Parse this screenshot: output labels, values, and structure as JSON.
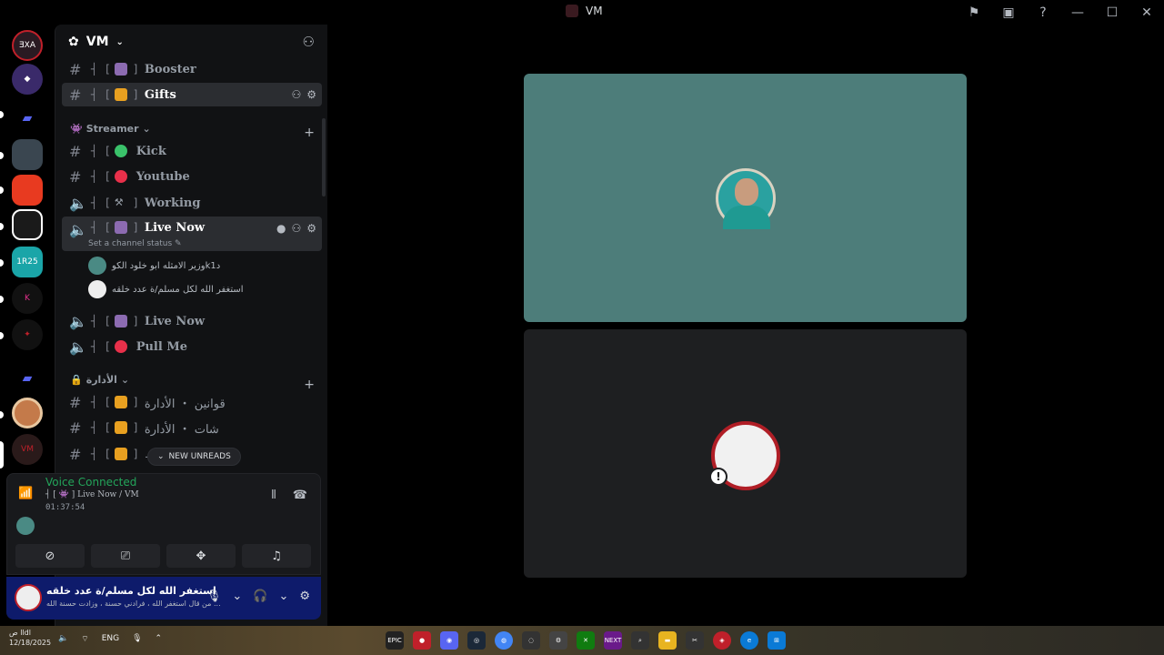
{
  "window": {
    "title": "VM"
  },
  "server": {
    "name": "VM"
  },
  "categories": {
    "streamer": "Streamer",
    "admin": "الأدارة"
  },
  "channels": {
    "booster": {
      "prefix": "┤ [",
      "suffix": "]",
      "name": "Booster"
    },
    "gifts": {
      "prefix": "┤ [",
      "suffix": "]",
      "name": "Gifts"
    },
    "kick": {
      "prefix": "┤ [",
      "name": "Kick"
    },
    "youtube": {
      "prefix": "┤ [",
      "name": "Youtube"
    },
    "working": {
      "prefix": "┤ [",
      "suffix": "]",
      "name": "Working"
    },
    "live_now_active": {
      "prefix": "┤ [",
      "suffix": "]",
      "name": "Live Now",
      "status": "Set a channel status"
    },
    "live_now": {
      "prefix": "┤ [",
      "suffix": "]",
      "name": "Live Now"
    },
    "pull_me": {
      "prefix": "┤ [",
      "name": "Pull Me"
    },
    "rules_admin": {
      "prefix": "┤ [",
      "suffix": "]",
      "name": "قوانين ・ الأدارة"
    },
    "chat_admin": {
      "prefix": "┤ [",
      "suffix": "]",
      "name": "شات ・ الأدارة"
    },
    "third_admin": {
      "prefix": "┤ [",
      "suffix": "] ـ",
      "name": ""
    }
  },
  "voice_users": [
    {
      "name": "وزير الامثله ابو خلود الكوk1د"
    },
    {
      "name": "استغفر الله لكل مسلم/ة عدد خلقه"
    }
  ],
  "new_unreads": "NEW UNREADS",
  "voice": {
    "title": "Voice Connected",
    "channel": "┤ [ 👾 ] Live Now / VM",
    "timer": "01:37:54"
  },
  "user": {
    "name": "استغفر الله لكل مسلم/ة عدد خلقه",
    "status": "من قال استغفر الله ، فرادني حسنة ، وزادت حسنة الله ..."
  },
  "taskbar": {
    "time": "ص lldl",
    "date": "12/18/2025",
    "lang": "ENG"
  },
  "colors": {
    "accent_green": "#23a55a",
    "tile_teal": "#4d7d7a",
    "panel_blue": "#0e1b6b"
  }
}
